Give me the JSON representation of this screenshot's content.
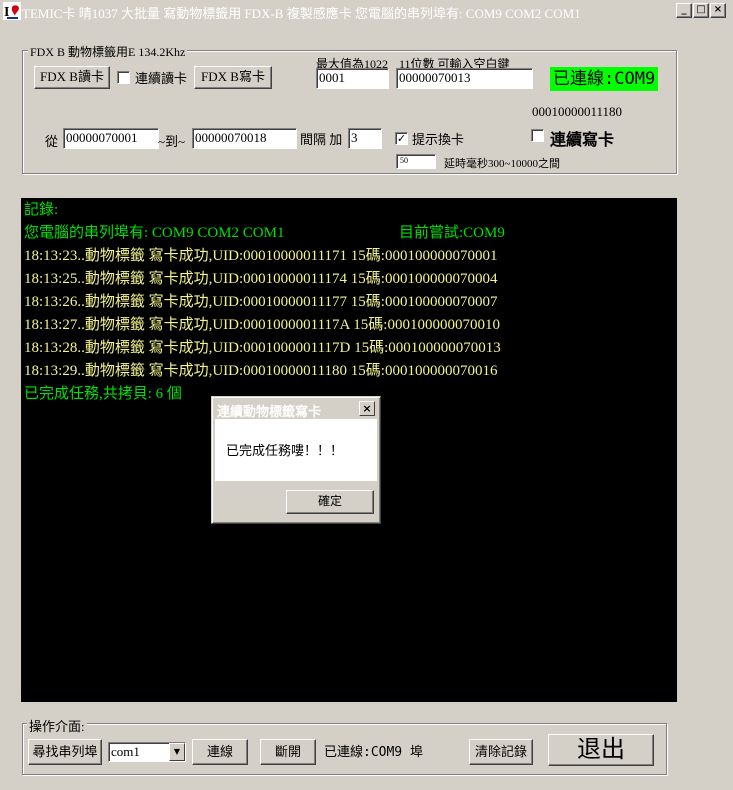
{
  "window": {
    "title": "TEMIC卡 晴1037  大批量 寫動物標籤用 FDX-B   複製感應卡   您電腦的串列埠有: COM9  COM2  COM1",
    "minimize_glyph": "_",
    "maximize_glyph": "□",
    "close_glyph": "×"
  },
  "fdx_group": {
    "label": "FDX B  動物標籤用E       134.2Khz",
    "read_button": "FDX B讀卡",
    "continuous_read_label": "連續讀卡",
    "continuous_read_checked": false,
    "write_button": "FDX B寫卡",
    "max_value_label": "最大值為1022",
    "digits_label": "11位數 可輸入空白鍵",
    "country_code_value": "0001",
    "id_value": "00000070013",
    "connection_status": "已連線:COM9",
    "uid_readout": "00010000011180",
    "from_label": "從",
    "from_value": "00000070001",
    "to_label": "~到~",
    "to_value": "00000070018",
    "interval_label": "間隔 加",
    "interval_value": "3",
    "prompt_change_label": "提示換卡",
    "prompt_change_checked": true,
    "continuous_write_label": "連續寫卡",
    "continuous_write_checked": false,
    "delay_value": "50",
    "delay_label": "延時毫秒300~10000之間"
  },
  "log": {
    "header": "記錄:",
    "ports_line": " 您電腦的串列埠有: COM9  COM2  COM1",
    "trying_line": "目前嘗試:COM9",
    "entries": [
      "18:13:23..動物標籤 寫卡成功,UID:00010000011171   15碼:000100000070001",
      "18:13:25..動物標籤 寫卡成功,UID:00010000011174   15碼:000100000070004",
      "18:13:26..動物標籤 寫卡成功,UID:00010000011177   15碼:000100000070007",
      "18:13:27..動物標籤 寫卡成功,UID:0001000001117A   15碼:000100000070010",
      "18:13:28..動物標籤 寫卡成功,UID:0001000001117D   15碼:000100000070013",
      "18:13:29..動物標籤 寫卡成功,UID:00010000011180   15碼:000100000070016"
    ],
    "done_line": "已完成任務,共拷貝: 6  個"
  },
  "dialog": {
    "title": "連續動物標籤寫卡",
    "close_glyph": "×",
    "message": "已完成任務嘍！！！",
    "ok_button": "確定"
  },
  "ops_group": {
    "label": "操作介面:",
    "find_ports_button": "尋找串列埠",
    "port_select_value": "com1",
    "connect_button": "連線",
    "disconnect_button": "斷開",
    "status_text": "已連線:COM9 埠",
    "clear_log_button": "清除記錄",
    "exit_button": "退出"
  },
  "colors": {
    "window_bg": "#d4d0c8",
    "console_bg": "#000000",
    "log_green": "#00e000",
    "log_yellow": "#f4f48c",
    "status_green": "#00ff00"
  }
}
